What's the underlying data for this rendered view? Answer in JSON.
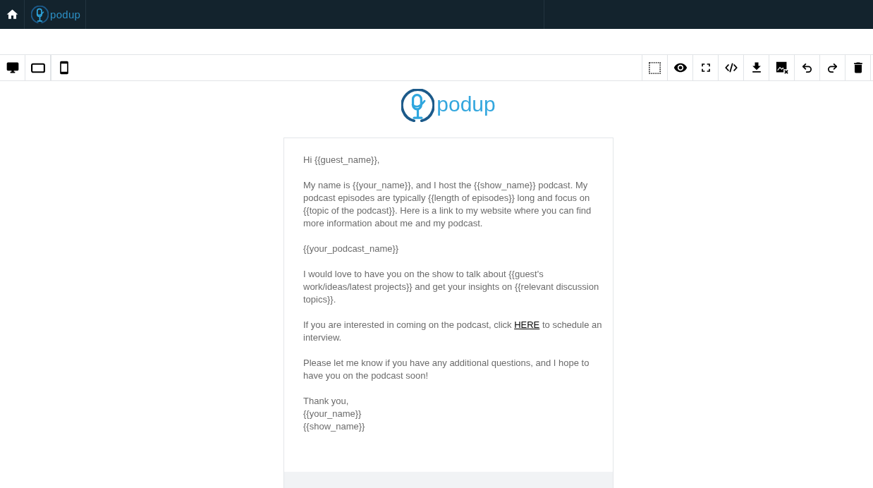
{
  "top_bar": {
    "logo": {
      "wordmark": "podup"
    }
  },
  "canvas": {
    "logo": {
      "wordmark": "podup"
    }
  },
  "email": {
    "paragraphs": [
      {
        "kind": "text",
        "text": "Hi {{guest_name}},"
      },
      {
        "kind": "text",
        "text": "My name is {{your_name}}, and I host the {{show_name}} podcast. My podcast episodes are typically {{length of episodes}} long and focus on {{topic of the podcast}}. Here is a link to my website where you can find more information about me and my podcast."
      },
      {
        "kind": "text",
        "text": "{{your_podcast_name}}"
      },
      {
        "kind": "text",
        "text": "I would love to have you on the show to talk about {{guest's work/ideas/latest projects}} and get your insights on {{relevant discussion topics}}."
      },
      {
        "kind": "link",
        "before": "If you are interested in coming on the podcast, click",
        "link": "HERE",
        "after": "to schedule an interview."
      },
      {
        "kind": "text",
        "text": "Please let me know if you have any additional questions, and I hope to have you on the podcast soon!"
      }
    ],
    "signature": [
      "Thank you,",
      "{{your_name}}",
      "{{show_name}}"
    ]
  }
}
